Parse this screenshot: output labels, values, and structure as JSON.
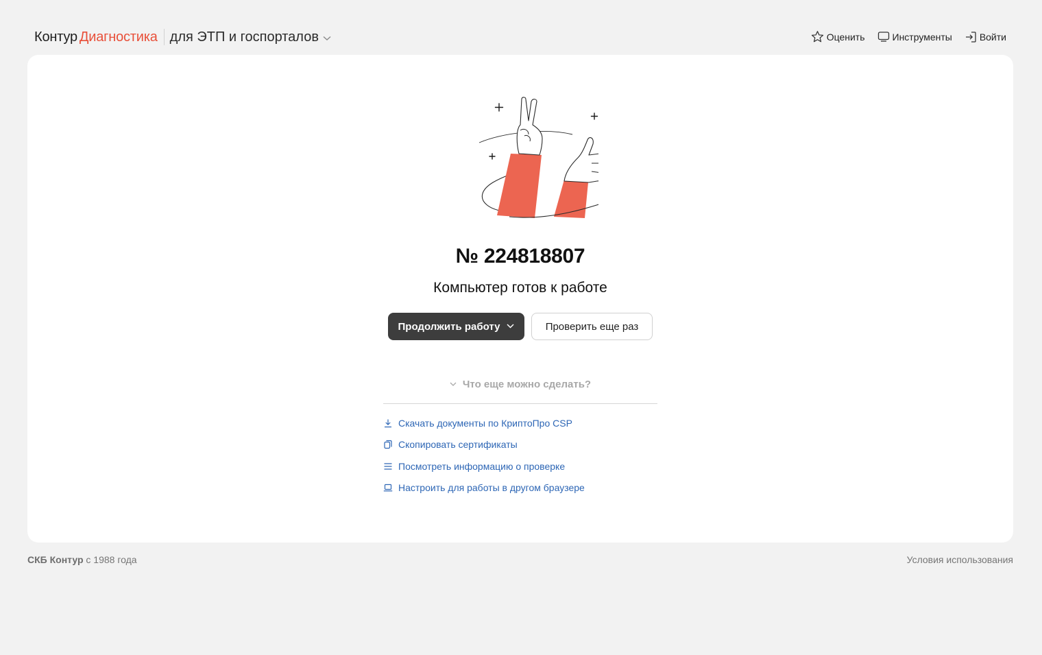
{
  "header": {
    "brand_company": "Контур",
    "brand_product": "Диагностика",
    "audience_label": "для ЭТП и госпорталов",
    "nav": {
      "rate_label": "Оценить",
      "tools_label": "Инструменты",
      "login_label": "Войти"
    }
  },
  "main": {
    "ticket_number": "№ 224818807",
    "status_text": "Компьютер готов к работе",
    "primary_button_label": "Продолжить работу",
    "secondary_button_label": "Проверить еще раз",
    "more_toggle_label": "Что еще можно сделать?",
    "more_items": [
      {
        "label": "Скачать документы по КриптоПро CSP",
        "icon": "download-icon"
      },
      {
        "label": "Скопировать сертификаты",
        "icon": "copy-icon"
      },
      {
        "label": "Посмотреть информацию о проверке",
        "icon": "list-icon"
      },
      {
        "label": "Настроить для работы в другом браузере",
        "icon": "laptop-icon"
      }
    ]
  },
  "footer": {
    "company": "СКБ Контур",
    "since": "с 1988 года",
    "terms_label": "Условия использования"
  },
  "colors": {
    "accent_red": "#e8503a",
    "link_blue": "#2d66b5",
    "primary_button": "#3d3d3d",
    "page_background": "#f2f2f2",
    "card_background": "#ffffff"
  }
}
